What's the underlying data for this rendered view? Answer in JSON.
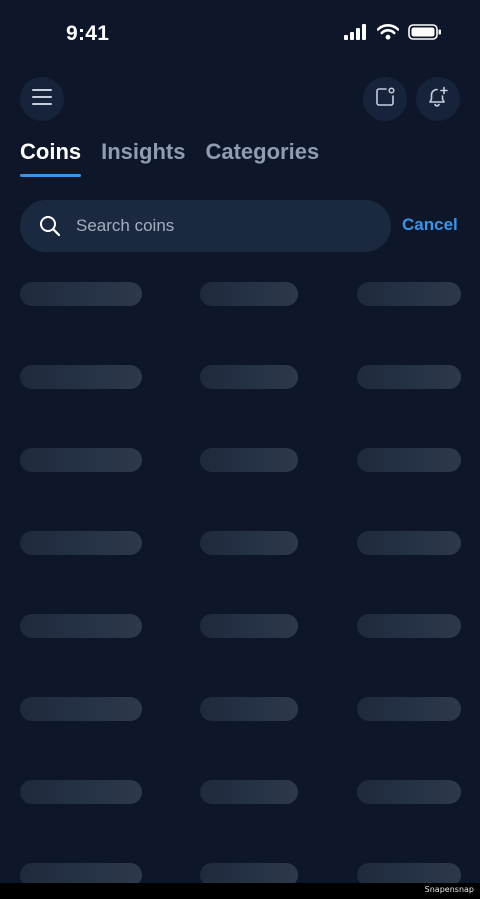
{
  "status_bar": {
    "time": "9:41"
  },
  "header": {
    "menu_icon": "hamburger-menu-icon",
    "note_icon": "note-badge-icon",
    "bell_icon": "bell-plus-icon"
  },
  "tabs": [
    {
      "label": "Coins",
      "active": true
    },
    {
      "label": "Insights",
      "active": false
    },
    {
      "label": "Categories",
      "active": false
    }
  ],
  "search": {
    "placeholder": "Search coins",
    "value": "",
    "cancel_label": "Cancel"
  },
  "colors": {
    "background": "#0d1729",
    "accent": "#3b93e6",
    "inactive_tab": "#8f9cb3",
    "search_bg": "#1b2940",
    "skeleton": "#263246"
  },
  "watermark": "Snapensnap"
}
